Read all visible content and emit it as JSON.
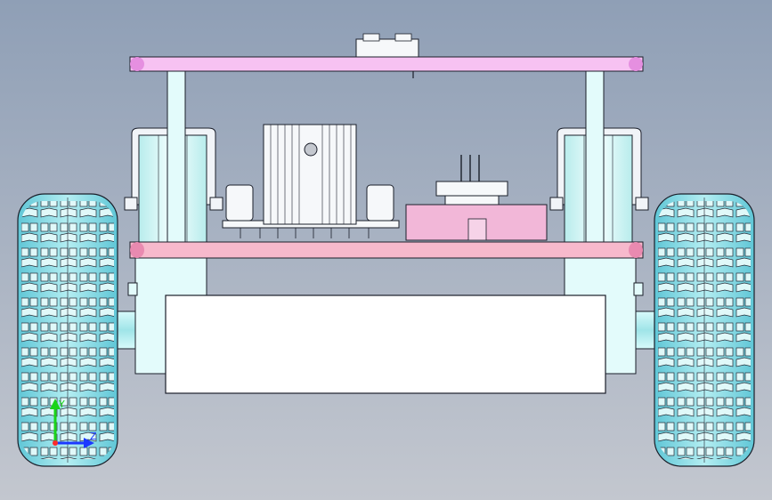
{
  "viewport": {
    "background_top": "#8f9fb6",
    "background_bottom": "#c3c7cf"
  },
  "colors": {
    "top_plate": "#f7c2f2",
    "bottom_plate": "#f7b9cc",
    "standoff": "#e3fbfb",
    "motor": "#e0fafa",
    "motor_bracket": "#f1f4f8",
    "tire": "#8fdde6",
    "tire_tread": "#e4fafa",
    "heatsink": "#f6f8fa",
    "board": "#f2b7d8",
    "outline": "#1b1f2a",
    "battery": "#ffffff",
    "axle": "#b6f1f2"
  },
  "triad": {
    "y_label": "Y",
    "z_label": "Z",
    "y_color": "#19d419",
    "z_color": "#1c38ff",
    "origin_color": "#ff2a2a"
  }
}
